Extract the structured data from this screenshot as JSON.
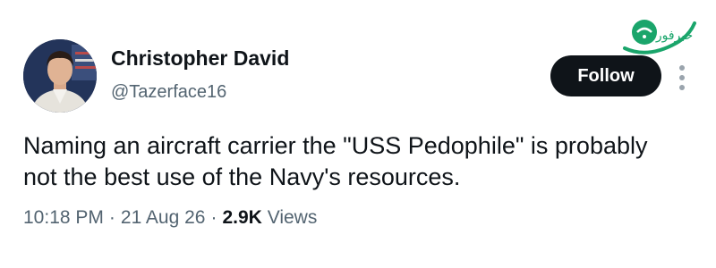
{
  "author": {
    "display_name": "Christopher David",
    "handle": "@Tazerface16"
  },
  "follow_label": "Follow",
  "tweet": {
    "line1": "Naming an aircraft carrier the \"USS Pedophile\" is probably",
    "line2": "not the best use of the Navy's resources."
  },
  "meta": {
    "time": "10:18 PM",
    "separator": "·",
    "date": "21 Aug 26",
    "views_count": "2.9K",
    "views_label": "Views"
  },
  "logo": {
    "text": "خبرفوری",
    "accent_color": "#1aa56b"
  },
  "icons": {
    "more": "more-vertical-icon",
    "logo": "news-logo-icon"
  },
  "colors": {
    "text_primary": "#0f1419",
    "text_secondary": "#536471",
    "button_bg": "#0f1419",
    "button_text": "#ffffff"
  }
}
